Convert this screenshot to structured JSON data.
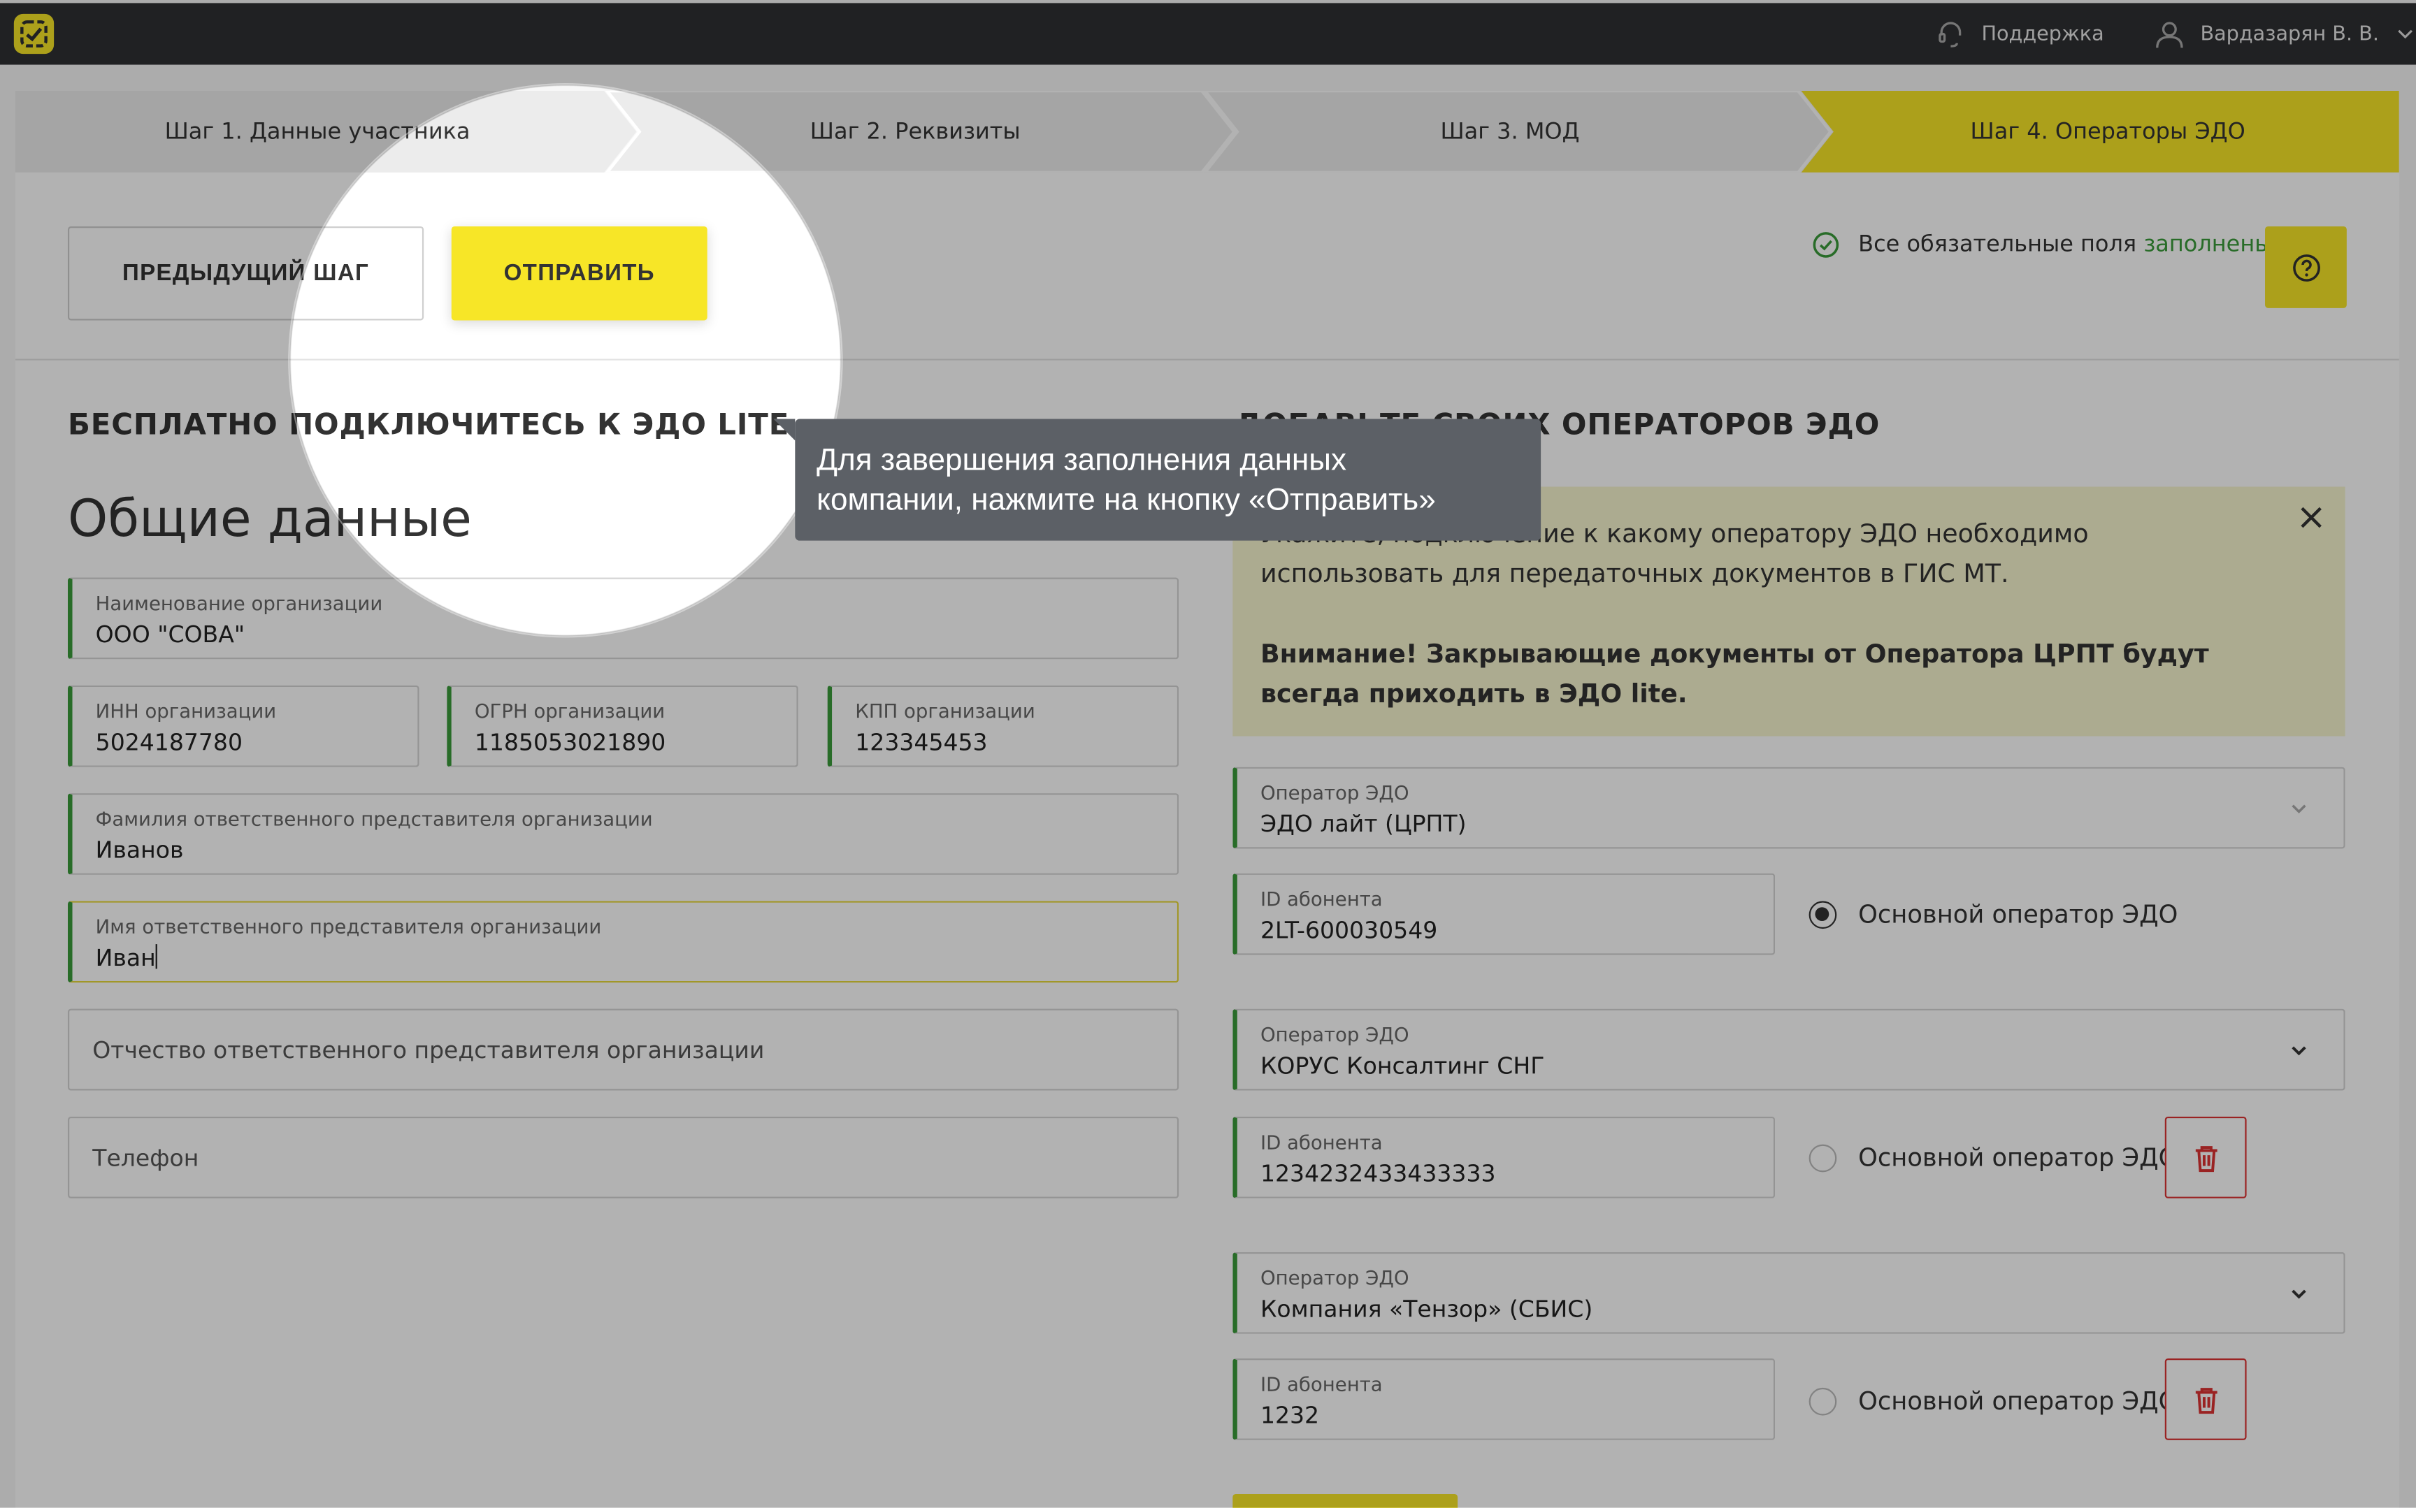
{
  "topbar": {
    "support_label": "Поддержка",
    "user_label": "Вардазарян В. В.",
    "icons": [
      "logo-icon",
      "headset-icon",
      "user-icon",
      "chevron-down-icon"
    ]
  },
  "steps": [
    {
      "label": "Шаг 1. Данные участника",
      "active": false
    },
    {
      "label": "Шаг 2. Реквизиты",
      "active": false
    },
    {
      "label": "Шаг 3. МОД",
      "active": false
    },
    {
      "label": "Шаг 4. Операторы ЭДО",
      "active": true
    }
  ],
  "toolbar": {
    "prev_label": "ПРЕДЫДУЩИЙ ШАГ",
    "send_label": "ОТПРАВИТЬ",
    "status_text": "Все обязательные поля ",
    "status_ok": "заполнены"
  },
  "left": {
    "section_title": "БЕСПЛАТНО ПОДКЛЮЧИТЕСЬ К ЭДО LITE",
    "heading": "Общие данные",
    "fields": {
      "org_name": {
        "label": "Наименование организации",
        "value": "ООО \"СОВА\""
      },
      "inn": {
        "label": "ИНН организации",
        "value": "5024187780"
      },
      "ogrn": {
        "label": "ОГРН организации",
        "value": "1185053021890"
      },
      "kpp": {
        "label": "КПП организации",
        "value": "123345453"
      },
      "surname": {
        "label": "Фамилия ответственного представителя организации",
        "value": "Иванов"
      },
      "name": {
        "label": "Имя ответственного представителя организации",
        "value": "Иван"
      },
      "patronymic": {
        "placeholder": "Отчество ответственного представителя организации"
      },
      "phone": {
        "placeholder": "Телефон"
      }
    }
  },
  "right": {
    "section_title": "ДОБАВЬТЕ СВОИХ ОПЕРАТОРОВ ЭДО",
    "info_line1": "Укажите, подключение к какому оператору ЭДО необходимо использовать для передаточных документов в ГИС МТ.",
    "info_line2": "Внимание! Закрывающие документы от Оператора ЦРПТ будут всегда приходить в ЭДО lite.",
    "operators": [
      {
        "op_label": "Оператор ЭДО",
        "op_value": "ЭДО лайт (ЦРПТ)",
        "id_label": "ID абонента",
        "id_value": "2LT-600030549",
        "radio_label": "Основной оператор ЭДО",
        "primary": true
      },
      {
        "op_label": "Оператор ЭДО",
        "op_value": "КОРУС Консалтинг СНГ",
        "id_label": "ID абонента",
        "id_value": "1234232433433333",
        "radio_label": "Основной оператор ЭДО",
        "primary": false
      },
      {
        "op_label": "Оператор ЭДО",
        "op_value": "Компания «Тензор» (СБИС)",
        "id_label": "ID абонента",
        "id_value": "1232",
        "radio_label": "Основной оператор ЭДО",
        "primary": false
      }
    ]
  },
  "tooltip": {
    "line1": "Для завершения заполнения данных",
    "line2": "компании, нажмите на кнопку «Отправить»"
  },
  "colors": {
    "accent": "#f7e627",
    "topbar": "#2f3033",
    "success": "#3a9b3a",
    "danger": "#dd3333",
    "tooltip": "#5c6066"
  }
}
